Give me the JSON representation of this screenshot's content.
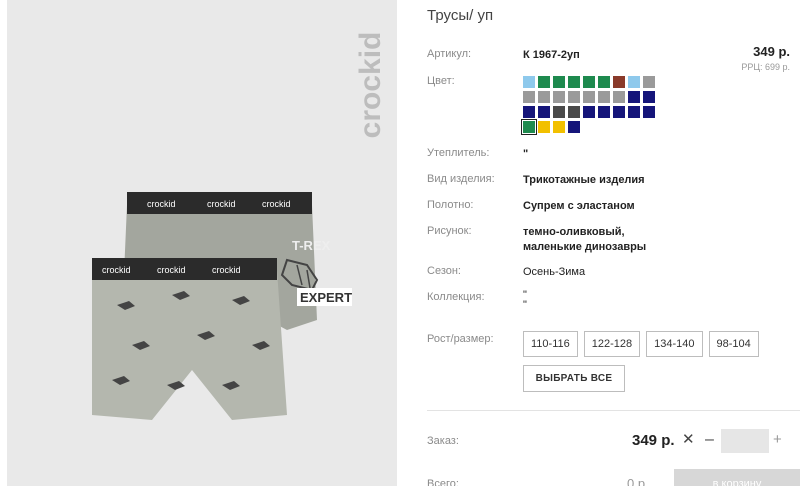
{
  "brand": {
    "logo_text": "crockid",
    "waistband_text": "crockid",
    "print_texts": [
      "T-REX",
      "EXPERT"
    ]
  },
  "product": {
    "title": "Трусы/ уп",
    "price": "349 р.",
    "rrp": "РРЦ: 699 р."
  },
  "attributes": {
    "article": {
      "label": "Артикул:",
      "value": "К 1967-2уп"
    },
    "color": {
      "label": "Цвет:"
    },
    "insulation": {
      "label": "Утеплитель:",
      "value": "\""
    },
    "product_type": {
      "label": "Вид изделия:",
      "value": "Трикотажные изделия"
    },
    "fabric": {
      "label": "Полотно:",
      "value": "Супрем с эластаном"
    },
    "pattern": {
      "label": "Рисунок:",
      "line1": "темно-оливковый,",
      "line2": "маленькие динозавры"
    },
    "season": {
      "label": "Сезон:",
      "value": "Осень-Зима"
    },
    "collection": {
      "label": "Коллекция:",
      "line1": "\"",
      "line2": "\""
    },
    "size": {
      "label": "Рост/размер:"
    }
  },
  "swatches": [
    [
      "#8ec9ec",
      "#1e8a4e",
      "#1e8a4e",
      "#1e8a4e",
      "#1e8a4e",
      "#1e8a4e",
      "#8a3a2a",
      "#8ec9ec",
      "#9a9a9a"
    ],
    [
      "#9a9a9a",
      "#9a9a9a",
      "#9a9a9a",
      "#9a9a9a",
      "#9a9a9a",
      "#9a9a9a",
      "#9a9a9a",
      "#15157a",
      "#15157a"
    ],
    [
      "#15157a",
      "#15157a",
      "#4a4a4a",
      "#4a4a4a",
      "#15157a",
      "#15157a",
      "#15157a",
      "#15157a",
      "#15157a"
    ],
    [
      "#1e8a4e",
      "#f2c000",
      "#f2c000",
      "#15157a"
    ]
  ],
  "sizes": [
    "110-116",
    "122-128",
    "134-140",
    "98-104"
  ],
  "select_all_label": "ВЫБРАТЬ ВСЕ",
  "order": {
    "label": "Заказ:",
    "price": "349 р.",
    "x": "✕",
    "minus": "–",
    "plus": "+",
    "quantity": ""
  },
  "total": {
    "label": "Всего:",
    "value": "0 р.",
    "cart_button": "в корзину"
  }
}
